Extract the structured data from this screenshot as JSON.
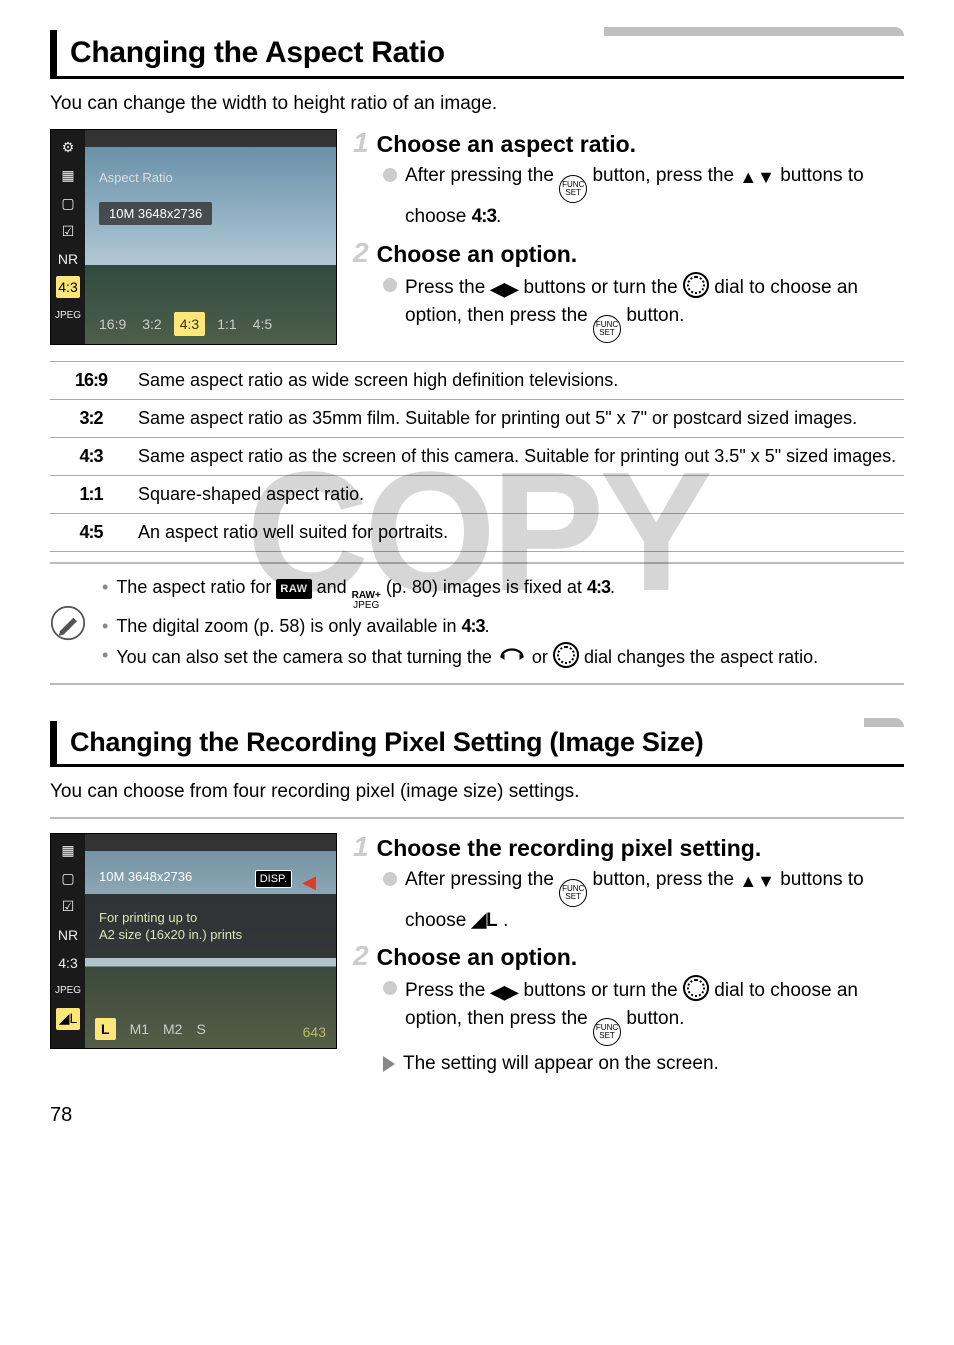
{
  "section1": {
    "title": "Changing the Aspect Ratio",
    "intro": "You can change the width to height ratio of an image.",
    "screenshot": {
      "menu_title": "Aspect Ratio",
      "resolution": "10M 3648x2736",
      "sidebar": [
        "⚙",
        "▦",
        "▢",
        "☑",
        "NR",
        "4:3",
        "JPEG"
      ],
      "options": [
        "16:9",
        "3:2",
        "4:3",
        "1:1",
        "4:5"
      ],
      "selected": "4:3"
    },
    "step1": {
      "title": "Choose an aspect ratio.",
      "line_a": "After pressing the",
      "line_b": "button, press the",
      "line_c": "buttons to choose",
      "target": "4:3",
      "line_d": "."
    },
    "step2": {
      "title": "Choose an option.",
      "line_a": "Press the",
      "line_b": "buttons or turn the",
      "line_c": "dial to choose an option, then press the",
      "line_d": "button."
    },
    "table": [
      {
        "k": "16:9",
        "v": "Same aspect ratio as wide screen high definition televisions."
      },
      {
        "k": "3:2",
        "v": "Same aspect ratio as 35mm film. Suitable for printing out 5\" x 7\" or postcard sized images."
      },
      {
        "k": "4:3",
        "v": "Same aspect ratio as the screen of this camera. Suitable for printing out 3.5\" x 5\" sized images."
      },
      {
        "k": "1:1",
        "v": "Square-shaped aspect ratio."
      },
      {
        "k": "4:5",
        "v": "An aspect ratio well suited for portraits."
      }
    ],
    "notes": {
      "n1_a": "The aspect ratio for",
      "n1_b": "and",
      "n1_c": "(p. 80) images is fixed at",
      "n1_d": "4:3",
      "n1_e": ".",
      "n2_a": "The digital zoom (p. 58) is only available in",
      "n2_b": "4:3",
      "n2_c": ".",
      "n3_a": "You can also set the camera so that turning the",
      "n3_b": "or",
      "n3_c": "dial changes the aspect ratio."
    }
  },
  "section2": {
    "title": "Changing the Recording Pixel Setting (Image Size)",
    "intro": "You can choose from four recording pixel (image size) settings.",
    "screenshot": {
      "value": "10M 3648x2736",
      "disp": "DISP.",
      "desc1": "For printing up to",
      "desc2": "A2 size (16x20 in.) prints",
      "sidebar": [
        "▦",
        "▢",
        "☑",
        "NR",
        "4:3",
        "JPEG",
        "◢L"
      ],
      "options": [
        "L",
        "M1",
        "M2",
        "S"
      ],
      "selected": "L",
      "count": "643"
    },
    "step1": {
      "title": "Choose the recording pixel setting.",
      "line_a": "After pressing the",
      "line_b": "button, press the",
      "line_c": "buttons to choose",
      "target_icon": "◢L",
      "line_d": "."
    },
    "step2": {
      "title": "Choose an option.",
      "line_a": "Press the",
      "line_b": "buttons or turn the",
      "line_c": "dial to choose an option, then press the",
      "line_d": "button.",
      "result": "The setting will appear on the screen."
    }
  },
  "page_number": "78",
  "watermark": "COPY"
}
